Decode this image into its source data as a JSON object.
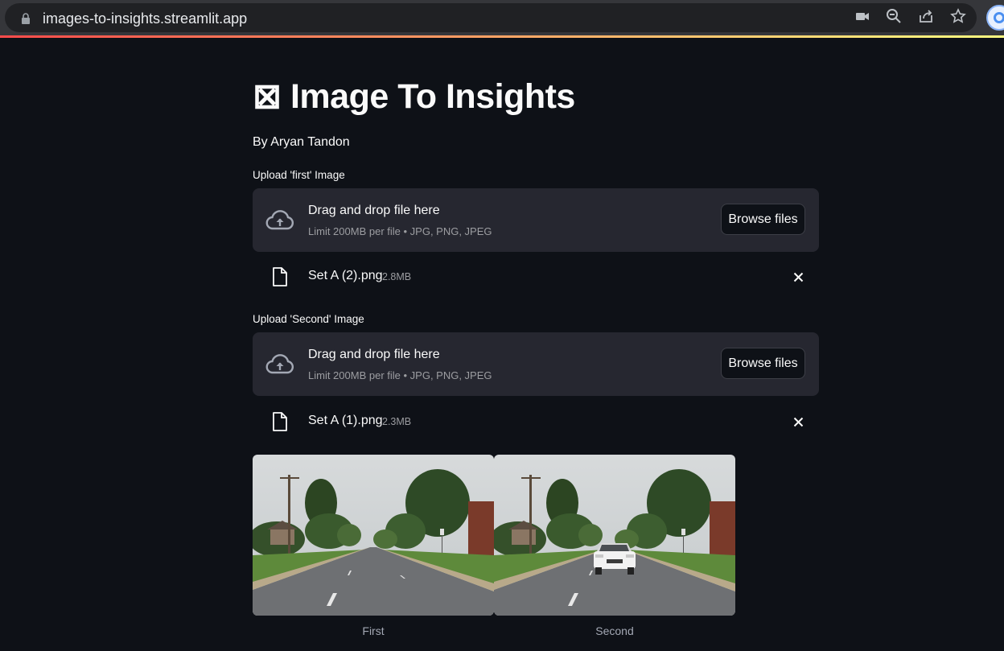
{
  "browser": {
    "url": "images-to-insights.streamlit.app",
    "icons": [
      "lock-icon",
      "camera-icon",
      "zoom-out-icon",
      "share-icon",
      "bookmark-star-icon",
      "profile-icon"
    ]
  },
  "app": {
    "title": "⊠ Image To Insights",
    "author": "By Aryan Tandon",
    "accent_colors": [
      "#ff4b4b",
      "#fffd80"
    ],
    "uploaders": [
      {
        "label": "Upload 'first' Image",
        "drop_title": "Drag and drop file here",
        "drop_limit": "Limit 200MB per file • JPG, PNG, JPEG",
        "browse_label": "Browse files",
        "file_name": "Set A (2).png",
        "file_size": "2.8MB"
      },
      {
        "label": "Upload 'Second' Image",
        "drop_title": "Drag and drop file here",
        "drop_limit": "Limit 200MB per file • JPG, PNG, JPEG",
        "browse_label": "Browse files",
        "file_name": "Set A (1).png",
        "file_size": "2.3MB"
      }
    ],
    "images": [
      {
        "caption": "First",
        "has_car": false
      },
      {
        "caption": "Second",
        "has_car": true
      }
    ]
  }
}
